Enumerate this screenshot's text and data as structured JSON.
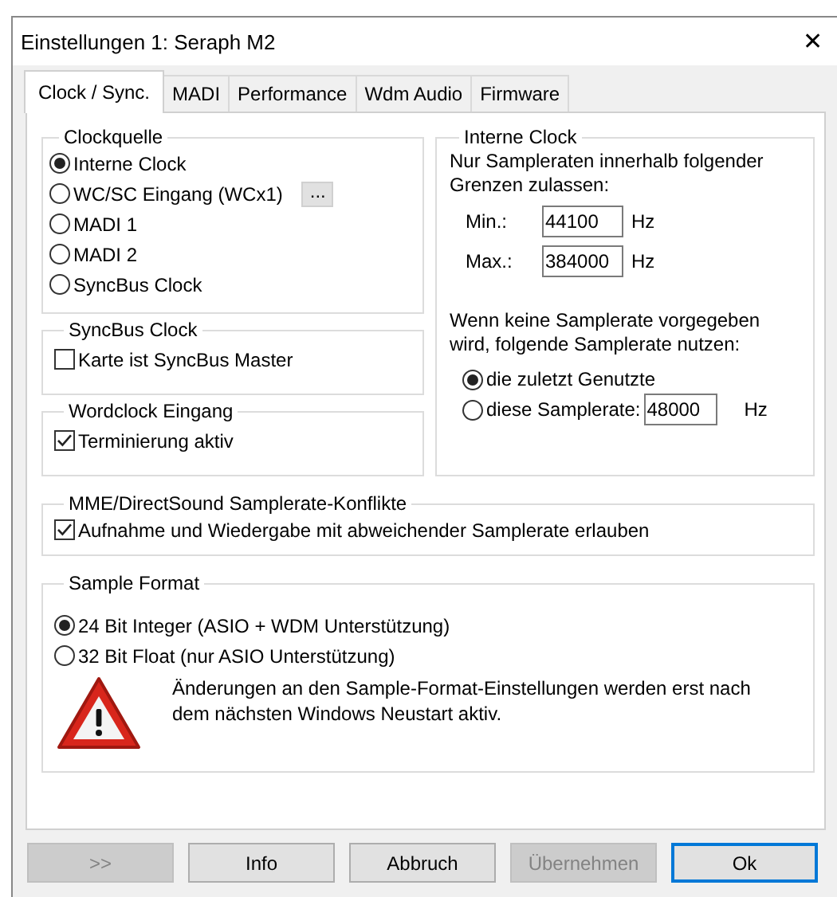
{
  "window": {
    "title": "Einstellungen 1: Seraph M2",
    "close": "✕"
  },
  "tabs": [
    {
      "label": "Clock / Sync.",
      "selected": true
    },
    {
      "label": "MADI",
      "selected": false
    },
    {
      "label": "Performance",
      "selected": false
    },
    {
      "label": "Wdm Audio",
      "selected": false
    },
    {
      "label": "Firmware",
      "selected": false
    }
  ],
  "clock_source": {
    "title": "Clockquelle",
    "options": [
      {
        "label": "Interne Clock",
        "selected": true
      },
      {
        "label": "WC/SC Eingang (WCx1)",
        "selected": false,
        "button": "..."
      },
      {
        "label": "MADI 1",
        "selected": false
      },
      {
        "label": "MADI 2",
        "selected": false
      },
      {
        "label": "SyncBus Clock",
        "selected": false
      }
    ]
  },
  "syncbus": {
    "title": "SyncBus Clock",
    "checkbox": {
      "label": "Karte ist SyncBus Master",
      "checked": false
    }
  },
  "wordclock": {
    "title": "Wordclock Eingang",
    "checkbox": {
      "label": "Terminierung aktiv",
      "checked": true
    }
  },
  "internal_clock": {
    "title": "Interne Clock",
    "description": "Nur Sampleraten innerhalb folgender Grenzen zulassen:",
    "limits": [
      {
        "label": "Min.:",
        "value": "44100",
        "unit": "Hz"
      },
      {
        "label": "Max.:",
        "value": "384000",
        "unit": "Hz"
      }
    ],
    "fallback_text": "Wenn keine Samplerate vorgegeben wird, folgende Samplerate nutzen:",
    "options": [
      {
        "label": "die zuletzt Genutzte",
        "selected": true
      },
      {
        "label": "diese Samplerate:",
        "selected": false,
        "value": "48000",
        "unit": "Hz"
      }
    ]
  },
  "conflicts": {
    "title": "MME/DirectSound Samplerate-Konflikte",
    "checkbox": {
      "label": "Aufnahme und Wiedergabe mit abweichender Samplerate erlauben",
      "checked": true
    }
  },
  "sample_format": {
    "title": "Sample Format",
    "options": [
      {
        "label": "24 Bit Integer (ASIO + WDM Unterstützung)",
        "selected": true
      },
      {
        "label": "32 Bit Float (nur ASIO Unterstützung)",
        "selected": false
      }
    ],
    "warning": "Änderungen an den Sample-Format-Einstellungen werden erst nach dem nächsten Windows Neustart aktiv."
  },
  "buttons": [
    {
      "label": ">>",
      "disabled": true,
      "default": false
    },
    {
      "label": "Info",
      "disabled": false,
      "default": false
    },
    {
      "label": "Abbruch",
      "disabled": false,
      "default": false
    },
    {
      "label": "Übernehmen",
      "disabled": true,
      "default": false
    },
    {
      "label": "Ok",
      "disabled": false,
      "default": true
    }
  ]
}
